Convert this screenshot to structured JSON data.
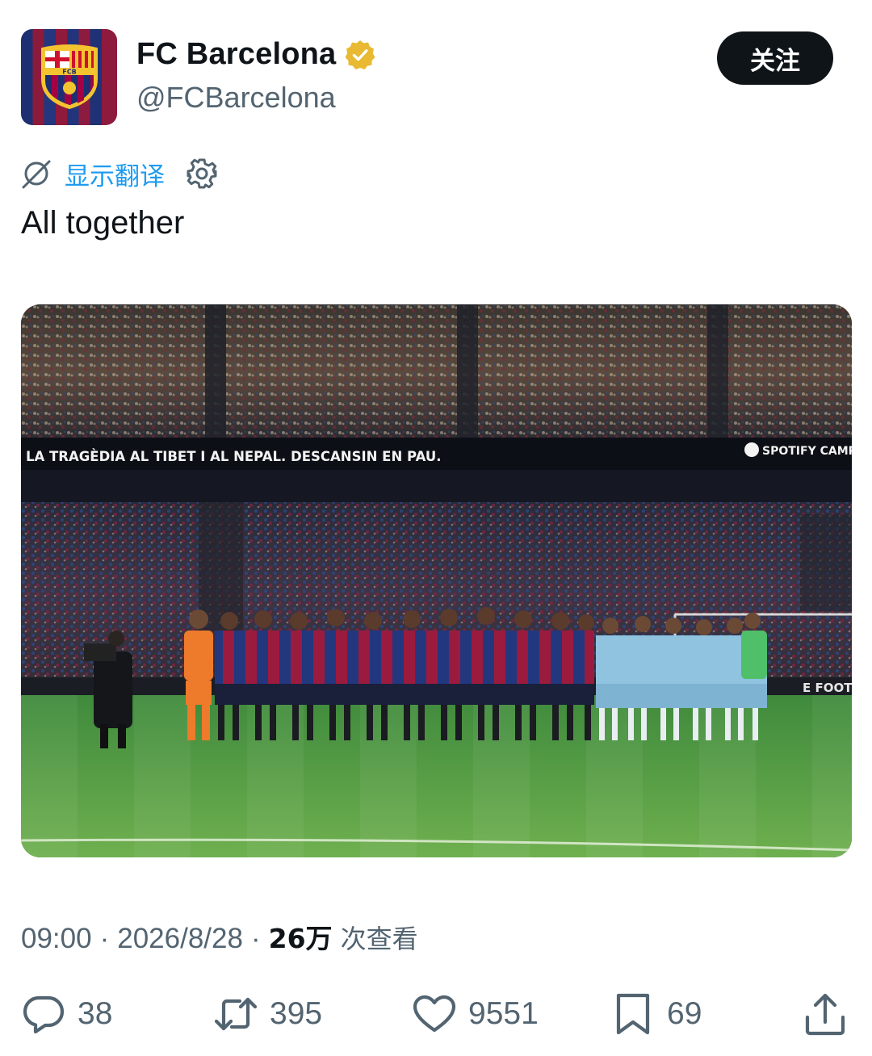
{
  "account": {
    "display_name": "FC Barcelona",
    "handle": "@FCBarcelona",
    "verified_badge_icon": "verified-badge-gold",
    "avatar_crest_letters": "FCB"
  },
  "follow_button": {
    "label": "关注"
  },
  "translate": {
    "icon": "translate-globe-icon",
    "label": "显示翻译",
    "settings_icon": "gear-icon"
  },
  "tweet": {
    "text": "All together"
  },
  "photo": {
    "banner_text": "LA TRAGÈDIA AL TIBET I AL NEPAL. DESCANSIN EN PAU.",
    "sponsor_text": "SPOTIFY CAMP",
    "board_text": "E FOOT"
  },
  "meta": {
    "time": "09:00",
    "separator": "·",
    "date": "2026/8/28",
    "views_count": "26万",
    "views_label": "次查看"
  },
  "actions": {
    "reply": {
      "icon": "reply-icon",
      "count": "38"
    },
    "retweet": {
      "icon": "retweet-icon",
      "count": "395"
    },
    "like": {
      "icon": "heart-icon",
      "count": "9551"
    },
    "bookmark": {
      "icon": "bookmark-icon",
      "count": "69"
    },
    "share": {
      "icon": "share-icon"
    }
  },
  "colors": {
    "text": "#0f1419",
    "secondary_text": "#536471",
    "link_blue": "#1d9bf0",
    "button_black": "#0f1419",
    "verified_gold": "#e8b931",
    "barca_blue": "#1d2f72",
    "barca_garnet": "#8c1b3b"
  }
}
